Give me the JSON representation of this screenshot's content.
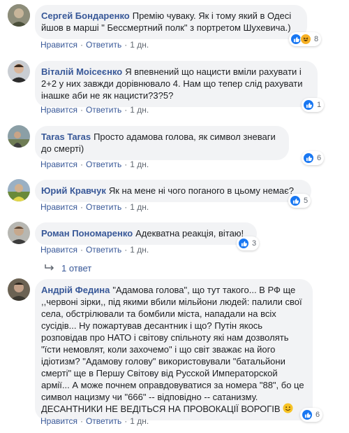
{
  "comments": [
    {
      "author": "Сергей Бондаренко",
      "text": "Премію чуваку. Як і тому який в Одесі йшов в марші \" Бессмертний полк\" з портретом Шухевича.)",
      "like_label": "Нравится",
      "reply_label": "Ответить",
      "time": "1 дн.",
      "reaction_count": "8",
      "reactions": [
        "like-icon",
        "haha-icon"
      ]
    },
    {
      "author": "Віталій Моісеєнко",
      "text": "Я впевнений що нацисти вміли рахувати і 2+2 у них завжди дорівнювало 4. Нам що тепер слід рахувати інашке аби не як нацисти?3?5?",
      "like_label": "Нравится",
      "reply_label": "Ответить",
      "time": "1 дн.",
      "reaction_count": "1",
      "reactions": [
        "like-icon"
      ]
    },
    {
      "author": "Taras Taras",
      "text": "Просто адамова голова, як символ зневаги до смерті)",
      "like_label": "Нравится",
      "reply_label": "Ответить",
      "time": "1 дн.",
      "reaction_count": "6",
      "reactions": [
        "like-icon"
      ]
    },
    {
      "author": "Юрий Кравчук",
      "text": "Як на мене ні чого поганого в цьому немає?",
      "like_label": "Нравится",
      "reply_label": "Ответить",
      "time": "1 дн.",
      "reaction_count": "5",
      "reactions": [
        "like-icon"
      ]
    },
    {
      "author": "Роман Пономаренко",
      "text": "Адекватна реакція, вітаю!",
      "like_label": "Нравится",
      "reply_label": "Ответить",
      "time": "1 дн.",
      "reaction_count": "3",
      "reactions": [
        "like-icon"
      ],
      "replies_label": "1 ответ"
    },
    {
      "author": "Андрій Федина",
      "text": "\"Адамова голова\", що тут такого... В РФ ще ,,червоні зірки,, під якими вбили мільйони людей: палили свої села, обстрілювали та бомбили міста, нападали на всіх сусідів... Ну пожартував десантник і що? Путін якось розповідав про НАТО і світову спільноту які нам дозволять \"їсти немовлят, коли захочемо\" і що світ зважає на його ідіотизм? \"Адамову голову\" використовували \"батальйони смерті\" ще в Першу Світову від Русской Императорской армії... А може почнем оправдовуватися за номера \"88\", бо це символ нацизму чи \"666\" -- відповідно -- сатанизму. ДЕСАНТНИКИ НЕ ВЕДІТЬСЯ НА ПРОВОКАЦІЇ ВОРОГІВ",
      "like_label": "Нравится",
      "reply_label": "Ответить",
      "time": "1 дн.",
      "reaction_count": "6",
      "reactions": [
        "like-icon"
      ]
    }
  ],
  "colors": {
    "author": "#385898",
    "bubble": "#f2f3f5",
    "like": "#1877f2",
    "haha": "#f7b125",
    "meta": "#606770"
  }
}
